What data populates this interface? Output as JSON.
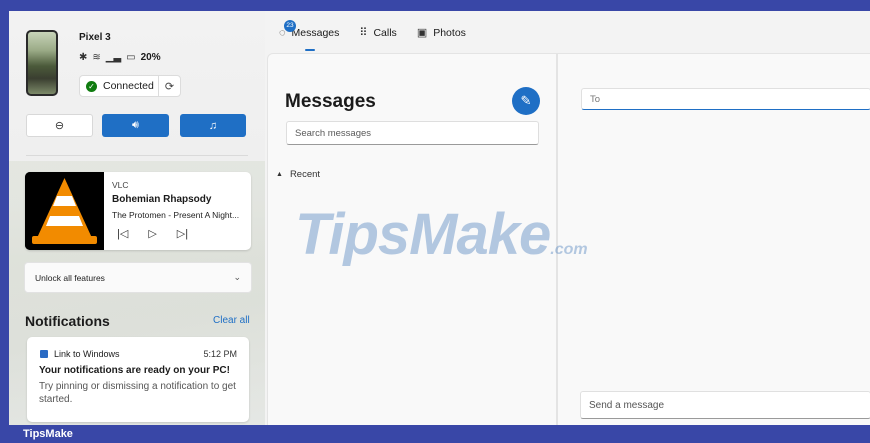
{
  "device": {
    "name": "Pixel 3",
    "battery": "20%",
    "status_icons": [
      "bluetooth-icon",
      "wifi-icon",
      "signal-icon",
      "battery-icon"
    ],
    "connection_label": "Connected"
  },
  "quick_actions": [
    "do-not-disturb-icon",
    "volume-icon",
    "music-icon"
  ],
  "media": {
    "app": "VLC",
    "title": "Bohemian Rhapsody",
    "artist": "The Protomen - Present A Night..."
  },
  "unlock_label": "Unlock all features",
  "notifications": {
    "heading": "Notifications",
    "clear_all": "Clear all",
    "items": [
      {
        "app": "Link to Windows",
        "time": "5:12 PM",
        "title": "Your notifications are ready on your PC!",
        "body": "Try pinning or dismissing a notification to get started."
      }
    ]
  },
  "tabs": [
    {
      "label": "Messages",
      "badge": "23",
      "active": true
    },
    {
      "label": "Calls"
    },
    {
      "label": "Photos"
    }
  ],
  "messages": {
    "heading": "Messages",
    "search_placeholder": "Search messages",
    "recent_label": "Recent"
  },
  "conversation": {
    "to_placeholder": "To",
    "send_placeholder": "Send a message"
  },
  "watermark": {
    "main": "TipsMake",
    "suffix": ".com"
  },
  "footer_brand": "TipsMake",
  "colors": {
    "accent": "#1f6fc5",
    "frame": "#3947a7",
    "connected": "#107c10"
  }
}
